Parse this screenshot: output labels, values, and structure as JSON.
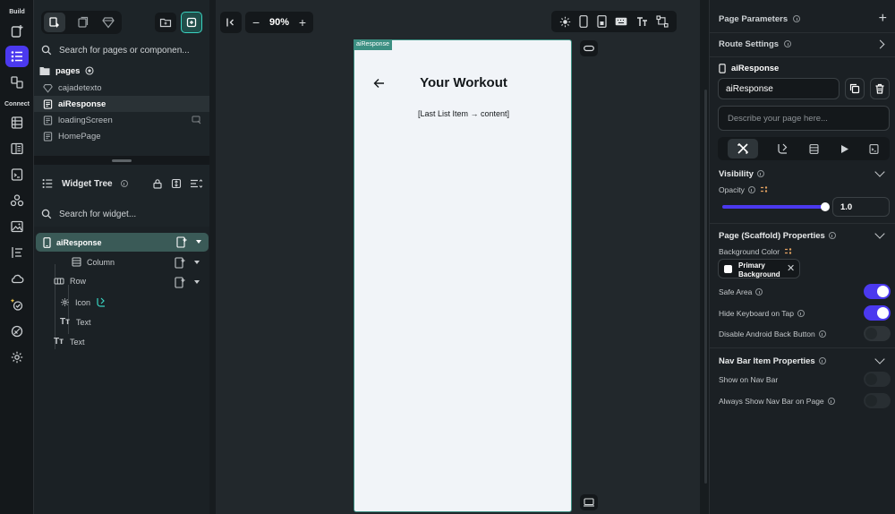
{
  "rail": {
    "build_label": "Build",
    "connect_label": "Connect"
  },
  "panel": {
    "search_placeholder": "Search for pages or componen...",
    "pages_label": "pages",
    "pages": [
      {
        "label": "cajadetexto",
        "icon": "component-icon"
      },
      {
        "label": "aiResponse",
        "icon": "page-icon",
        "selected": true
      },
      {
        "label": "loadingScreen",
        "icon": "page-icon"
      },
      {
        "label": "HomePage",
        "icon": "page-icon"
      }
    ],
    "widget_tree_title": "Widget Tree",
    "widget_search_placeholder": "Search for widget...",
    "tree": [
      {
        "label": "aiResponse",
        "icon": "phone-icon"
      },
      {
        "label": "Column",
        "icon": "column-icon"
      },
      {
        "label": "Row",
        "icon": "row-icon"
      },
      {
        "label": "Icon",
        "icon": "settings-icon"
      },
      {
        "label": "Text",
        "icon": "text-icon"
      },
      {
        "label": "Text",
        "icon": "text-icon"
      }
    ]
  },
  "canvas": {
    "zoom": "90%",
    "page_tag": "aiResponse",
    "screen_title": "Your Workout",
    "content_text": "[Last List Item → content]"
  },
  "right": {
    "page_parameters": "Page Parameters",
    "route_settings": "Route Settings",
    "page_name_label": "aiResponse",
    "page_name_value": "aiResponse",
    "describe_placeholder": "Describe your page here...",
    "visibility_title": "Visibility",
    "opacity_label": "Opacity",
    "opacity_value": "1.0",
    "opacity_level": 1.0,
    "scaffold_title": "Page (Scaffold) Properties",
    "bg_color_label": "Background Color",
    "bg_color_value": "Primary Background",
    "safe_area_label": "Safe Area",
    "safe_area_on": true,
    "hide_keyboard_label": "Hide Keyboard on Tap",
    "hide_keyboard_on": true,
    "disable_back_label": "Disable Android Back Button",
    "disable_back_on": false,
    "navbar_title": "Nav Bar Item Properties",
    "show_navbar_label": "Show on Nav Bar",
    "show_navbar_on": false,
    "always_show_navbar_label": "Always Show Nav Bar on Page",
    "always_show_navbar_on": false
  },
  "colors": {
    "accent": "#4b39ef",
    "teal": "#39d2c0",
    "page_tag_bg": "#3c8f82",
    "screen_bg": "#f1f4f8"
  }
}
